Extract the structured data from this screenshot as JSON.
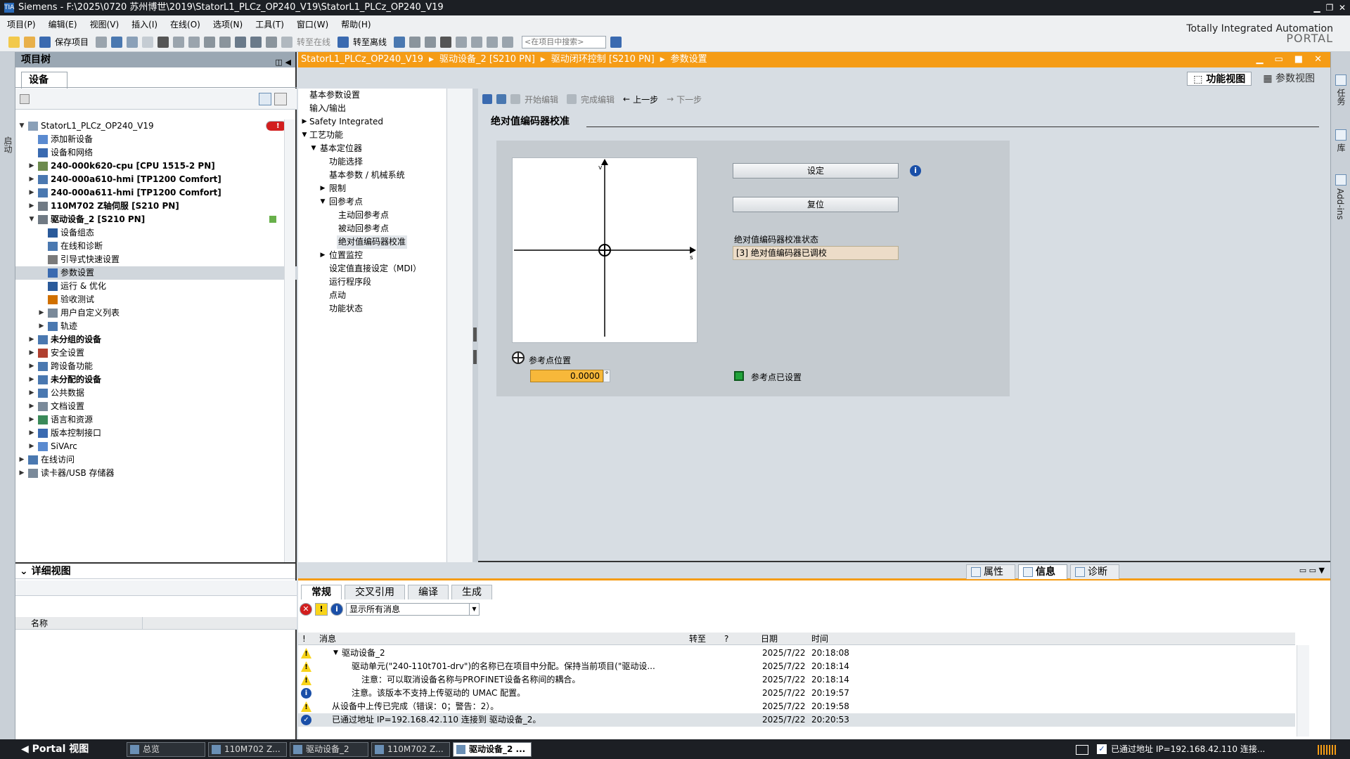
{
  "window": {
    "title": "Siemens  -  F:\\2025\\0720 苏州博世\\2019\\StatorL1_PLCz_OP240_V19\\StatorL1_PLCz_OP240_V19",
    "logo": "TIA"
  },
  "menu": [
    "项目(P)",
    "编辑(E)",
    "视图(V)",
    "插入(I)",
    "在线(O)",
    "选项(N)",
    "工具(T)",
    "窗口(W)",
    "帮助(H)"
  ],
  "toolbar": {
    "save_label": "保存项目",
    "go_online": "转至在线",
    "go_offline": "转至离线",
    "search_placeholder": "<在项目中搜索>"
  },
  "brand": {
    "line1": "Totally Integrated Automation",
    "line2": "PORTAL"
  },
  "left_strip_label": "启动",
  "project_tree": {
    "title": "项目树",
    "tab": "设备",
    "items": [
      {
        "level": 0,
        "arrow": "▼",
        "label": "StatorL1_PLCz_OP240_V19",
        "bold": false,
        "status": "error",
        "color": "#8aa0b8"
      },
      {
        "level": 1,
        "arrow": "",
        "label": "添加新设备",
        "bold": false,
        "color": "#5a8ad0"
      },
      {
        "level": 1,
        "arrow": "",
        "label": "设备和网络",
        "bold": false,
        "color": "#3a6ab0"
      },
      {
        "level": 1,
        "arrow": "▶",
        "label": "240-000k620-cpu [CPU 1515-2 PN]",
        "bold": true,
        "color": "#6d8b4e"
      },
      {
        "level": 1,
        "arrow": "▶",
        "label": "240-000a610-hmi [TP1200 Comfort]",
        "bold": true,
        "color": "#4a78b0"
      },
      {
        "level": 1,
        "arrow": "▶",
        "label": "240-000a611-hmi [TP1200 Comfort]",
        "bold": true,
        "color": "#4a78b0"
      },
      {
        "level": 1,
        "arrow": "▶",
        "label": "110M702 Z轴伺服 [S210 PN]",
        "bold": true,
        "color": "#707a84"
      },
      {
        "level": 1,
        "arrow": "▼",
        "label": "驱动设备_2 [S210 PN]",
        "bold": true,
        "status": "ok",
        "color": "#707a84"
      },
      {
        "level": 2,
        "arrow": "",
        "label": "设备组态",
        "bold": false,
        "color": "#2a5a9a"
      },
      {
        "level": 2,
        "arrow": "",
        "label": "在线和诊断",
        "bold": false,
        "color": "#4a78b0"
      },
      {
        "level": 2,
        "arrow": "",
        "label": "引导式快速设置",
        "bold": false,
        "color": "#7a7a7a"
      },
      {
        "level": 2,
        "arrow": "",
        "label": "参数设置",
        "bold": false,
        "selected": true,
        "color": "#3a6ab0"
      },
      {
        "level": 2,
        "arrow": "",
        "label": "运行 & 优化",
        "bold": false,
        "color": "#2a5a9a"
      },
      {
        "level": 2,
        "arrow": "",
        "label": "验收测试",
        "bold": false,
        "color": "#d07000"
      },
      {
        "level": 2,
        "arrow": "▶",
        "label": "用户自定义列表",
        "bold": false,
        "color": "#7a8a9a"
      },
      {
        "level": 2,
        "arrow": "▶",
        "label": "轨迹",
        "bold": false,
        "color": "#4a78b0"
      },
      {
        "level": 1,
        "arrow": "▶",
        "label": "未分组的设备",
        "bold": true,
        "color": "#4a78b0"
      },
      {
        "level": 1,
        "arrow": "▶",
        "label": "安全设置",
        "bold": false,
        "color": "#b04030"
      },
      {
        "level": 1,
        "arrow": "▶",
        "label": "跨设备功能",
        "bold": false,
        "color": "#4a78b0"
      },
      {
        "level": 1,
        "arrow": "▶",
        "label": "未分配的设备",
        "bold": true,
        "color": "#4a78b0"
      },
      {
        "level": 1,
        "arrow": "▶",
        "label": "公共数据",
        "bold": false,
        "color": "#4a78b0"
      },
      {
        "level": 1,
        "arrow": "▶",
        "label": "文档设置",
        "bold": false,
        "color": "#7a8a9a"
      },
      {
        "level": 1,
        "arrow": "▶",
        "label": "语言和资源",
        "bold": false,
        "color": "#3a8a5a"
      },
      {
        "level": 1,
        "arrow": "▶",
        "label": "版本控制接口",
        "bold": false,
        "color": "#3a6ab0"
      },
      {
        "level": 1,
        "arrow": "▶",
        "label": "SiVArc",
        "bold": false,
        "color": "#5a8ad0"
      },
      {
        "level": 0,
        "arrow": "▶",
        "label": "在线访问",
        "bold": false,
        "color": "#4a78b0"
      },
      {
        "level": 0,
        "arrow": "▶",
        "label": "读卡器/USB 存储器",
        "bold": false,
        "color": "#7a8a9a"
      }
    ]
  },
  "detail_view": {
    "title": "详细视图",
    "col_name": "名称"
  },
  "breadcrumb": [
    "StatorL1_PLCz_OP240_V19",
    "驱动设备_2 [S210 PN]",
    "驱动闭环控制 [S210 PN]",
    "参数设置"
  ],
  "view_tabs": {
    "func": "功能视图",
    "param": "参数视图"
  },
  "nav_tree": [
    {
      "indent": 0,
      "arrow": "",
      "label": "基本参数设置"
    },
    {
      "indent": 0,
      "arrow": "",
      "label": "输入/输出"
    },
    {
      "indent": 0,
      "arrow": "▶",
      "label": "Safety Integrated",
      "warn": true
    },
    {
      "indent": 0,
      "arrow": "▼",
      "label": "工艺功能"
    },
    {
      "indent": 1,
      "arrow": "▼",
      "label": "基本定位器"
    },
    {
      "indent": 2,
      "arrow": "",
      "label": "功能选择"
    },
    {
      "indent": 2,
      "arrow": "",
      "label": "基本参数 / 机械系统"
    },
    {
      "indent": 2,
      "arrow": "▶",
      "label": "限制"
    },
    {
      "indent": 2,
      "arrow": "▼",
      "label": "回参考点"
    },
    {
      "indent": 3,
      "arrow": "",
      "label": "主动回参考点"
    },
    {
      "indent": 3,
      "arrow": "",
      "label": "被动回参考点"
    },
    {
      "indent": 3,
      "arrow": "",
      "label": "绝对值编码器校准",
      "selected": true
    },
    {
      "indent": 2,
      "arrow": "▶",
      "label": "位置监控"
    },
    {
      "indent": 2,
      "arrow": "",
      "label": "设定值直接设定（MDI）"
    },
    {
      "indent": 2,
      "arrow": "",
      "label": "运行程序段"
    },
    {
      "indent": 2,
      "arrow": "",
      "label": "点动"
    },
    {
      "indent": 2,
      "arrow": "",
      "label": "功能状态"
    }
  ],
  "param_toolbar": {
    "start_edit": "开始编辑",
    "finish_edit": "完成编辑",
    "prev": "上一步",
    "next": "下一步"
  },
  "section_title": "绝对值编码器校准",
  "plot": {
    "y_axis": "v",
    "x_axis": "s"
  },
  "buttons": {
    "set": "设定",
    "reset": "复位"
  },
  "status": {
    "label": "绝对值编码器校准状态",
    "value": "[3] 绝对值编码器已调校"
  },
  "ref_point": {
    "label": "参考点位置",
    "value": "0.0000",
    "unit": "°"
  },
  "ref_set": {
    "label": "参考点已设置",
    "color": "#21a33a"
  },
  "right_strip": [
    "任务",
    "库",
    "Add-ins"
  ],
  "bottom_tabs": {
    "props": "属性",
    "info": "信息",
    "diag": "诊断"
  },
  "sub_tabs": [
    "常规",
    "交叉引用",
    "编译",
    "生成"
  ],
  "msg_filter": "显示所有消息",
  "msg_columns": {
    "flag": "!",
    "msg": "消息",
    "goto": "转至",
    "q": "?",
    "date": "日期",
    "time": "时间"
  },
  "messages": [
    {
      "icon": "wrn",
      "indent": 1,
      "arrow": "▼",
      "msg": "驱动设备_2",
      "date": "2025/7/22",
      "time": "20:18:08"
    },
    {
      "icon": "wrn",
      "indent": 2,
      "arrow": "",
      "msg": "驱动单元(\"240-110t701-drv\")的名称已在项目中分配。保持当前项目(\"驱动设...",
      "date": "2025/7/22",
      "time": "20:18:14"
    },
    {
      "icon": "wrn",
      "indent": 3,
      "arrow": "",
      "msg": "注意：可以取消设备名称与PROFINET设备名称间的耦合。",
      "date": "2025/7/22",
      "time": "20:18:14"
    },
    {
      "icon": "inf",
      "indent": 2,
      "arrow": "",
      "msg": "注意。该版本不支持上传驱动的 UMAC 配置。",
      "date": "2025/7/22",
      "time": "20:19:57"
    },
    {
      "icon": "wrn",
      "indent": 0,
      "arrow": "",
      "msg": "从设备中上传已完成（错误：0；警告：2）。",
      "date": "2025/7/22",
      "time": "20:19:58"
    },
    {
      "icon": "ok",
      "indent": 0,
      "arrow": "",
      "msg": "已通过地址 IP=192.168.42.110 连接到 驱动设备_2。",
      "date": "2025/7/22",
      "time": "20:20:53",
      "selected": true
    }
  ],
  "taskbar": {
    "portal": "Portal 视图",
    "tasks": [
      "总览",
      "110M702 Z...",
      "驱动设备_2",
      "110M702 Z...",
      "驱动设备_2 ..."
    ],
    "status": "已通过地址 IP=192.168.42.110 连接..."
  },
  "colors": {
    "accent": "#f59c16",
    "titlebar": "#1c1f24",
    "warn": "#f9d41a",
    "info": "#1a4fa8"
  }
}
